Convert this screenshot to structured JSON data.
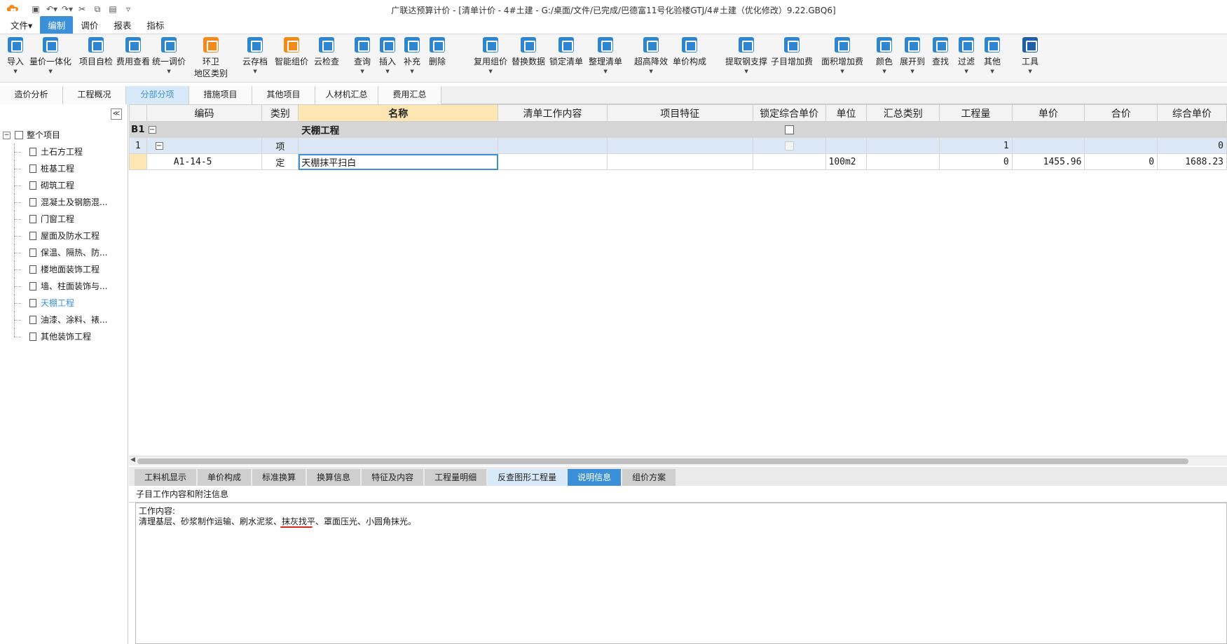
{
  "window": {
    "title": "广联达预算计价 - [清单计价 - 4#土建 - G:/桌面/文件/已完成/巴德富11号化验楼GTJ/4#土建（优化修改）9.22.GBQ6]"
  },
  "menu": [
    "文件▾",
    "编制",
    "调价",
    "报表",
    "指标"
  ],
  "ribbon": {
    "buttons": [
      {
        "label": "导入",
        "drop": true
      },
      {
        "label": "量价一体化",
        "drop": true
      },
      {
        "label": "项目自检",
        "drop": false
      },
      {
        "label": "费用查看",
        "drop": false
      },
      {
        "label": "统一调价",
        "drop": true
      },
      {
        "label": "环卫",
        "label2": "地区类别",
        "drop": false
      },
      {
        "label": "云存档",
        "drop": true
      },
      {
        "label": "智能组价",
        "drop": false
      },
      {
        "label": "云检查",
        "drop": false
      },
      {
        "label": "查询",
        "drop": true
      },
      {
        "label": "插入",
        "drop": true
      },
      {
        "label": "补充",
        "drop": true
      },
      {
        "label": "删除",
        "drop": false
      },
      {
        "label": "复用组价",
        "drop": true
      },
      {
        "label": "替换数据",
        "drop": false
      },
      {
        "label": "锁定清单",
        "drop": false
      },
      {
        "label": "整理清单",
        "drop": true
      },
      {
        "label": "超高降效",
        "drop": true
      },
      {
        "label": "单价构成",
        "drop": false
      },
      {
        "label": "提取钢支撑",
        "drop": false
      },
      {
        "label": "子目增加费",
        "drop": false
      },
      {
        "label": "面积增加费",
        "drop": true
      },
      {
        "label": "颜色",
        "drop": true
      },
      {
        "label": "展开到",
        "drop": true
      },
      {
        "label": "查找",
        "drop": false
      },
      {
        "label": "过滤",
        "drop": true
      },
      {
        "label": "其他",
        "drop": true
      },
      {
        "label": "工具",
        "drop": true
      }
    ]
  },
  "view_tabs": [
    "造价分析",
    "工程概况",
    "分部分项",
    "措施项目",
    "其他项目",
    "人材机汇总",
    "费用汇总"
  ],
  "tree": {
    "collapse_glyph": "≪",
    "root": "整个项目",
    "root_toggle": "−",
    "items": [
      "土石方工程",
      "桩基工程",
      "砌筑工程",
      "混凝土及钢筋混...",
      "门窗工程",
      "屋面及防水工程",
      "保温、隔热、防...",
      "楼地面装饰工程",
      "墙、柱面装饰与...",
      "天棚工程",
      "油漆、涂料、裱...",
      "其他装饰工程"
    ],
    "selected": "天棚工程"
  },
  "grid": {
    "headers": [
      "编码",
      "类别",
      "名称",
      "清单工作内容",
      "项目特征",
      "锁定综合单价",
      "单位",
      "汇总类别",
      "工程量",
      "单价",
      "合价",
      "综合单价"
    ],
    "rows": [
      {
        "no": "B1",
        "toggle": "−",
        "code": "",
        "type": "",
        "name": "天棚工程",
        "content": "",
        "feature": "",
        "unit": "",
        "sum": "",
        "qty": "",
        "price": "",
        "total": "",
        "cprice": ""
      },
      {
        "no": "1",
        "toggle": "−",
        "code": "",
        "type": "项",
        "name": "",
        "content": "",
        "feature": "",
        "unit": "",
        "sum": "",
        "qty": "1",
        "price": "",
        "total": "",
        "cprice": "0"
      },
      {
        "no": "",
        "toggle": "",
        "code": "A1-14-5",
        "type": "定",
        "name": "天棚抹平扫白",
        "content": "",
        "feature": "",
        "unit": "100m2",
        "sum": "",
        "qty": "0",
        "price": "1455.96",
        "total": "0",
        "cprice": "1688.23"
      }
    ]
  },
  "bottom_tabs": [
    "工料机显示",
    "单价构成",
    "标准换算",
    "换算信息",
    "特征及内容",
    "工程量明细",
    "反查图形工程量",
    "说明信息",
    "组价方案"
  ],
  "notes": {
    "title": "子目工作内容和附注信息",
    "line1": "工作内容:",
    "line2": "清理基层、砂浆制作运输、刷水泥浆、抹灰找平、罩面压光、小圆角抹光。"
  }
}
